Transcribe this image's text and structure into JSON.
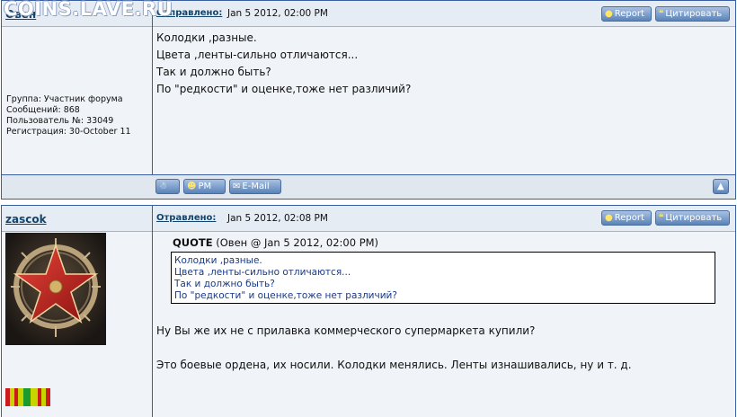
{
  "watermark": "COINS.LAVE.RU",
  "posts": [
    {
      "author": "Овен",
      "sent_label": "Отправлено:",
      "date": "Jan 5 2012, 02:00 PM",
      "report_label": "Report",
      "quote_label": "Цитировать",
      "user": {
        "group": "Группа: Участник форума",
        "messages": "Сообщений: 868",
        "user_no": "Пользователь №: 33049",
        "registered": "Регистрация: 30-October 11"
      },
      "lines": [
        "Колодки ,разные.",
        "Цвета ,ленты-сильно отличаются...",
        "Так и должно быть?",
        "По \"редкости\" и оценке,тоже нет различий?"
      ],
      "footer": {
        "pm_label": "PM",
        "email_label": "E-Mail"
      }
    },
    {
      "author": "zascok",
      "sent_label": "Отравлено:",
      "date": "Jan 5 2012, 02:08 PM",
      "report_label": "Report",
      "quote_label": "Цитировать",
      "quote": {
        "title": "QUOTE",
        "source": "(Овен @ Jan 5 2012, 02:00 PM)",
        "lines": [
          "Колодки ,разные.",
          "Цвета ,ленты-сильно отличаются...",
          "Так и должно быть?",
          "По \"редкости\" и оценке,тоже нет различий?"
        ]
      },
      "lines": [
        "Ну Вы же их не с прилавка коммерческого супермаркета купили?",
        "Это боевые ордена, их носили. Колодки менялись. Ленты изнашивались, ну и т. д."
      ]
    }
  ],
  "colors": {
    "border": "#3a5ea0",
    "header_bg": "#e6ecf3",
    "link": "#14446a",
    "quote_text": "#1a3a86",
    "button": "#5a83b8"
  }
}
